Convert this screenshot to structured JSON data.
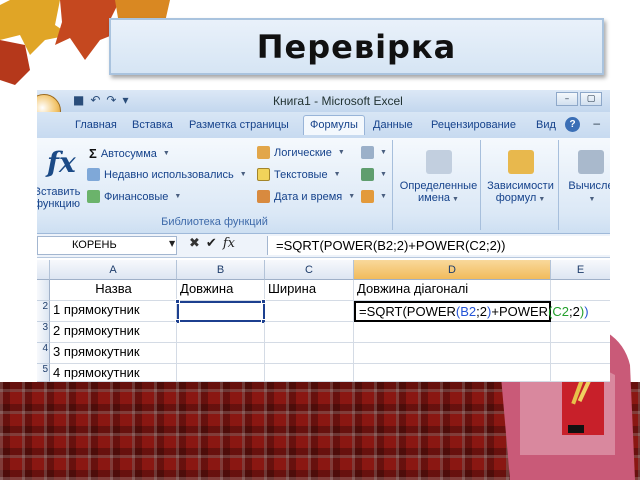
{
  "slide": {
    "title": "Перевірка"
  },
  "window": {
    "title": "Книга1 - Microsoft Excel",
    "controls": [
      "–",
      "▢",
      "✕"
    ]
  },
  "tabs": [
    {
      "label": "Главная"
    },
    {
      "label": "Вставка"
    },
    {
      "label": "Разметка страницы"
    },
    {
      "label": "Формулы",
      "active": true
    },
    {
      "label": "Данные"
    },
    {
      "label": "Рецензирование"
    },
    {
      "label": "Вид"
    }
  ],
  "ribbon": {
    "insert_function": {
      "line1": "Вставить",
      "line2": "функцию"
    },
    "commands_left": [
      {
        "label": "Автосумма",
        "icon": "sigma-icon"
      },
      {
        "label": "Недавно использовались",
        "icon": "recent-icon"
      },
      {
        "label": "Финансовые",
        "icon": "finance-icon"
      }
    ],
    "commands_right": [
      {
        "label": "Логические",
        "icon": "logical-icon"
      },
      {
        "label": "Текстовые",
        "icon": "text-icon"
      },
      {
        "label": "Дата и время",
        "icon": "calendar-icon"
      }
    ],
    "library_label": "Библиотека функций",
    "defined_names": {
      "line1": "Определенные",
      "line2": "имена"
    },
    "formula_auditing": {
      "line1": "Зависимости",
      "line2": "формул"
    },
    "calculation": {
      "line1": "Вычисле",
      "line2": ""
    }
  },
  "formula_bar": {
    "name_box": "КОРЕНЬ",
    "fx": "fx",
    "formula": "=SQRT(POWER(B2;2)+POWER(C2;2))"
  },
  "sheet": {
    "columns": [
      "A",
      "B",
      "C",
      "D",
      "E"
    ],
    "header_row": [
      "Назва",
      "Довжина",
      "Ширина",
      "Довжина діагоналі",
      ""
    ],
    "rows": [
      {
        "num": "2",
        "name": "1 прямокутник"
      },
      {
        "num": "3",
        "name": "2 прямокутник"
      },
      {
        "num": "4",
        "name": "3 прямокутник"
      },
      {
        "num": "5",
        "name": "4 прямокутник"
      }
    ],
    "editing_cell": {
      "prefix": "=SQRT(POWER",
      "p1": "(",
      "ref1": "B2",
      "mid1": ";2",
      "p2": ")",
      "mid2": "+POWER",
      "p3": "(",
      "ref2": "C2",
      "mid3": ";2",
      "p4": ")",
      "suffix": ")"
    }
  }
}
